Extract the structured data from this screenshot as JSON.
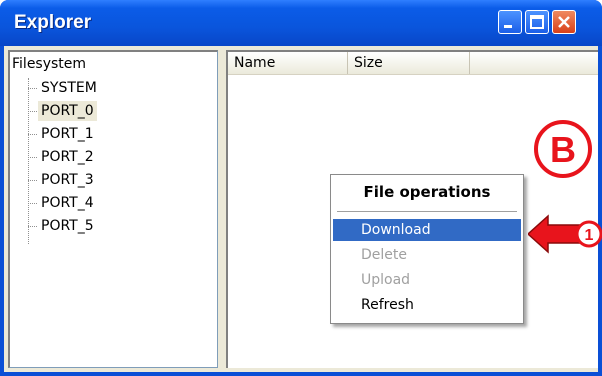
{
  "window": {
    "title": "Explorer"
  },
  "tree": {
    "root": "Filesystem",
    "items": [
      "SYSTEM",
      "PORT_0",
      "PORT_1",
      "PORT_2",
      "PORT_3",
      "PORT_4",
      "PORT_5"
    ],
    "selected": "PORT_0"
  },
  "list": {
    "columns": [
      "Name",
      "Size"
    ]
  },
  "context_menu": {
    "title": "File operations",
    "items": [
      {
        "label": "Download",
        "state": "highlighted"
      },
      {
        "label": "Delete",
        "state": "disabled"
      },
      {
        "label": "Upload",
        "state": "disabled"
      },
      {
        "label": "Refresh",
        "state": "enabled"
      }
    ]
  },
  "annotations": {
    "badge": "B",
    "step": "1"
  },
  "colors": {
    "title_bar": "#0a55dc",
    "highlight": "#316ac5",
    "annotation_red": "#e8141c"
  }
}
